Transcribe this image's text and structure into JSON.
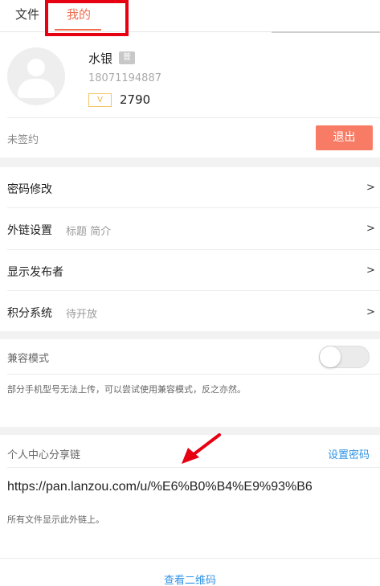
{
  "tabs": {
    "files_label": "文件",
    "mine_label": "我的"
  },
  "profile": {
    "name": "水银",
    "badge": "普",
    "phone": "18071194887",
    "vip_label": "V",
    "points": "2790"
  },
  "sign": {
    "status": "未签约",
    "logout_label": "退出"
  },
  "settings": {
    "rows": [
      {
        "label": "密码修改",
        "sub": "",
        "arrow": ">"
      },
      {
        "label": "外链设置",
        "sub": "标题 简介",
        "arrow": ">"
      },
      {
        "label": "显示发布者",
        "sub": "",
        "arrow": ">"
      },
      {
        "label": "积分系统",
        "sub": "待开放",
        "arrow": ">"
      }
    ]
  },
  "compat": {
    "label": "兼容模式",
    "enabled": false,
    "description": "部分手机型号无法上传，可以尝试使用兼容模式，反之亦然。"
  },
  "share": {
    "title": "个人中心分享链",
    "set_password_label": "设置密码",
    "url": "https://pan.lanzou.com/u/%E6%B0%B4%E9%93%B6",
    "note": "所有文件显示此外链上。",
    "qr_label": "查看二维码"
  },
  "colors": {
    "accent": "#f06d4f",
    "logout": "#f87c65",
    "link": "#2f93e6",
    "highlight_box": "#e60012"
  }
}
